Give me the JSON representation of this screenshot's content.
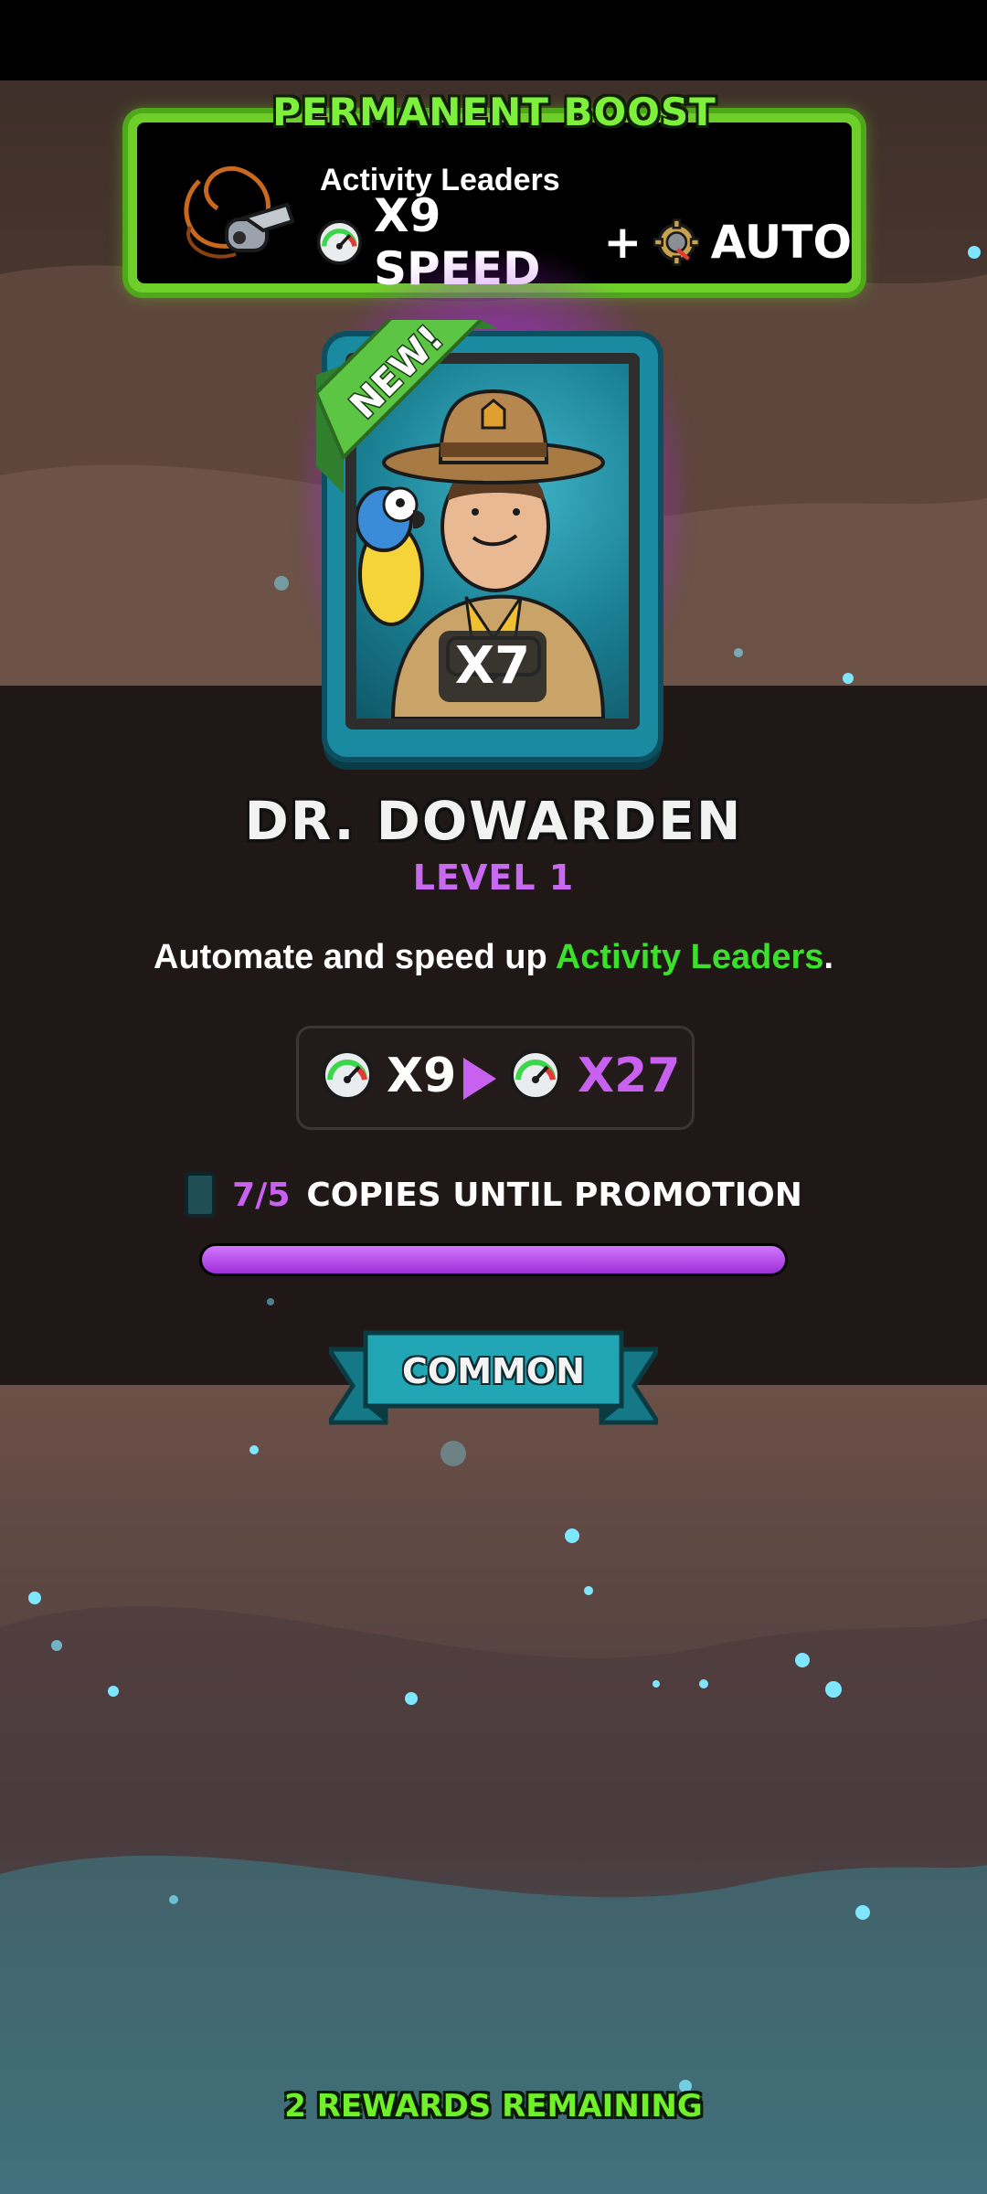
{
  "boost": {
    "title": "PERMANENT BOOST",
    "target": "Activity Leaders",
    "speed_label": "X9 SPEED",
    "plus": "+",
    "auto_label": "AUTO"
  },
  "card": {
    "ribbon": "NEW!",
    "count": "X7",
    "name": "DR. DOWARDEN",
    "level": "LEVEL 1"
  },
  "description": {
    "prefix": "Automate and speed up ",
    "highlight": "Activity Leaders",
    "suffix": "."
  },
  "upgrade": {
    "from": "X9",
    "to": "X27"
  },
  "promotion": {
    "count": "7/5",
    "label": "COPIES UNTIL PROMOTION",
    "progress": 1.0
  },
  "rarity": "COMMON",
  "footer": "2 REWARDS REMAINING",
  "colors": {
    "accent_purple": "#c860f0",
    "accent_green": "#3ae02a",
    "card_teal": "#1a8aa0"
  },
  "icons": [
    "whistle-icon",
    "speed-gauge-icon",
    "auto-gear-icon",
    "play-arrow-icon",
    "card-copy-icon"
  ]
}
